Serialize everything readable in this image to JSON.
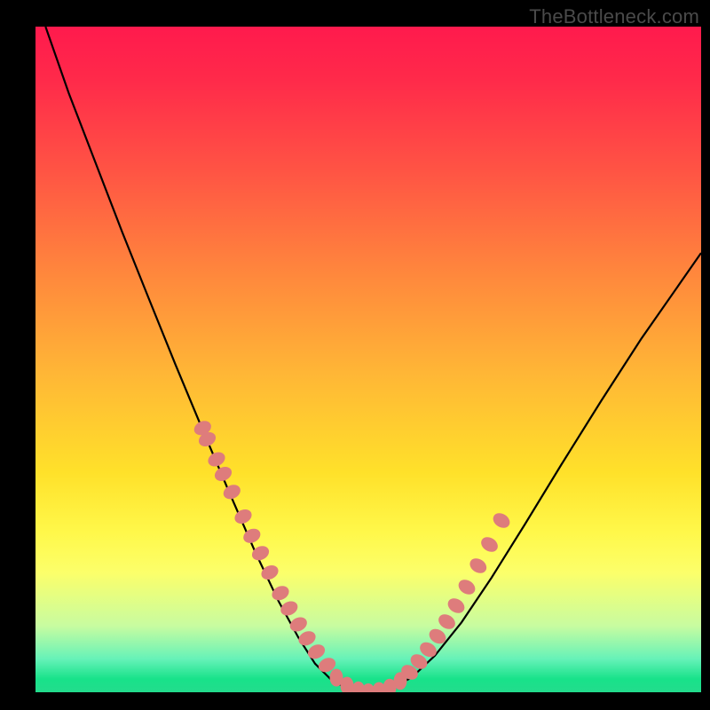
{
  "watermark": "TheBottleneck.com",
  "chart_data": {
    "type": "line",
    "title": "",
    "xlabel": "",
    "ylabel": "",
    "xlim": [
      0,
      1
    ],
    "ylim": [
      0,
      1
    ],
    "gradient_stops": [
      {
        "pos": 0.0,
        "color": "#ff1a4d"
      },
      {
        "pos": 0.5,
        "color": "#ffd633"
      },
      {
        "pos": 0.82,
        "color": "#fff84a"
      },
      {
        "pos": 1.0,
        "color": "#23dc8c"
      }
    ],
    "series": [
      {
        "name": "v-curve",
        "color": "#000000",
        "x": [
          0.015,
          0.05,
          0.09,
          0.13,
          0.17,
          0.21,
          0.25,
          0.29,
          0.33,
          0.365,
          0.395,
          0.42,
          0.445,
          0.47,
          0.5,
          0.53,
          0.565,
          0.6,
          0.64,
          0.685,
          0.735,
          0.79,
          0.85,
          0.91,
          0.97,
          1.0
        ],
        "y": [
          1.0,
          0.9,
          0.796,
          0.692,
          0.592,
          0.493,
          0.397,
          0.303,
          0.211,
          0.137,
          0.082,
          0.043,
          0.018,
          0.005,
          0.0,
          0.004,
          0.022,
          0.055,
          0.105,
          0.172,
          0.252,
          0.342,
          0.438,
          0.531,
          0.617,
          0.66
        ]
      },
      {
        "name": "left-overlay-dots",
        "color": "#de7c7c",
        "x": [
          0.251,
          0.258,
          0.272,
          0.282,
          0.295,
          0.312,
          0.325,
          0.338,
          0.352,
          0.368,
          0.381,
          0.395,
          0.408,
          0.422,
          0.438
        ],
        "y": [
          0.397,
          0.38,
          0.35,
          0.328,
          0.301,
          0.264,
          0.235,
          0.209,
          0.18,
          0.149,
          0.126,
          0.102,
          0.081,
          0.061,
          0.041
        ]
      },
      {
        "name": "bottom-overlay-dots",
        "color": "#de7c7c",
        "x": [
          0.452,
          0.468,
          0.485,
          0.5,
          0.516,
          0.532,
          0.548
        ],
        "y": [
          0.022,
          0.01,
          0.003,
          0.0,
          0.002,
          0.007,
          0.017
        ]
      },
      {
        "name": "right-overlay-dots",
        "color": "#de7c7c",
        "x": [
          0.562,
          0.576,
          0.59,
          0.604,
          0.618,
          0.632,
          0.648,
          0.665,
          0.682,
          0.7
        ],
        "y": [
          0.03,
          0.046,
          0.064,
          0.084,
          0.106,
          0.13,
          0.158,
          0.19,
          0.222,
          0.258
        ]
      }
    ]
  }
}
